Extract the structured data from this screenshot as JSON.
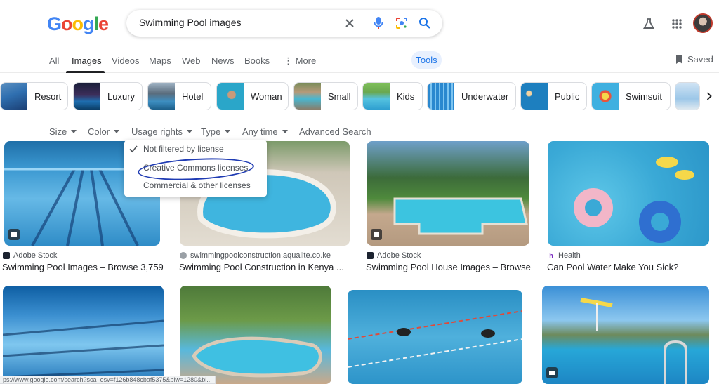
{
  "logo": {
    "text": "Google"
  },
  "search": {
    "query": "Swimming Pool images"
  },
  "tabs": [
    {
      "label": "All"
    },
    {
      "label": "Images"
    },
    {
      "label": "Videos"
    },
    {
      "label": "Maps"
    },
    {
      "label": "Web"
    },
    {
      "label": "News"
    },
    {
      "label": "Books"
    },
    {
      "label": "More"
    }
  ],
  "tools_label": "Tools",
  "saved_label": "Saved",
  "chips": [
    {
      "label": "Resort"
    },
    {
      "label": "Luxury"
    },
    {
      "label": "Hotel"
    },
    {
      "label": "Woman"
    },
    {
      "label": "Small"
    },
    {
      "label": "Kids"
    },
    {
      "label": "Underwater"
    },
    {
      "label": "Public"
    },
    {
      "label": "Swimsuit"
    }
  ],
  "filters": [
    {
      "label": "Size"
    },
    {
      "label": "Color"
    },
    {
      "label": "Usage rights"
    },
    {
      "label": "Type"
    },
    {
      "label": "Any time"
    },
    {
      "label": "Advanced Search"
    }
  ],
  "dropdown": {
    "items": [
      {
        "label": "Not filtered by license",
        "selected": true
      },
      {
        "label": "Creative Commons licenses",
        "selected": false
      },
      {
        "label": "Commercial & other licenses",
        "selected": false
      }
    ]
  },
  "results": [
    {
      "source": "Adobe Stock",
      "caption": "Swimming Pool Images – Browse 3,759,..."
    },
    {
      "source": "swimmingpoolconstruction.aqualite.co.ke",
      "caption": "Swimming Pool Construction in Kenya ..."
    },
    {
      "source": "Adobe Stock",
      "caption": "Swimming Pool House Images – Browse ..."
    },
    {
      "source": "Health",
      "caption": "Can Pool Water Make You Sick?"
    }
  ],
  "status_url": "ps://www.google.com/search?sca_esv=f126b848cbaf5375&biw=1280&bi...",
  "colors": {
    "accent": "#1a73e8",
    "circle": "#1f3bb3",
    "tools_bg": "#e8f0fe"
  }
}
